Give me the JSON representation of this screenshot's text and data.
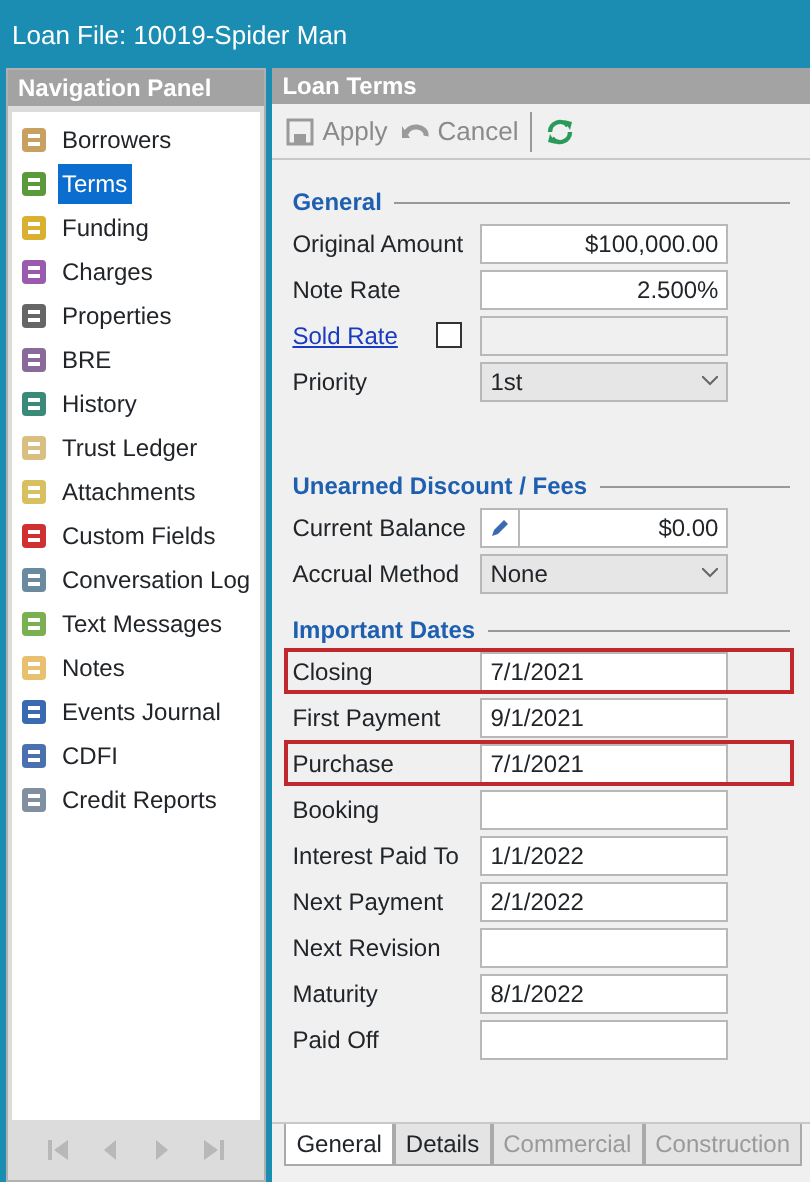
{
  "window": {
    "title": "Loan File: 10019-Spider Man"
  },
  "navigation_panel": {
    "title": "Navigation Panel",
    "items": [
      {
        "label": "Borrowers",
        "selected": false
      },
      {
        "label": "Terms",
        "selected": true
      },
      {
        "label": "Funding",
        "selected": false
      },
      {
        "label": "Charges",
        "selected": false
      },
      {
        "label": "Properties",
        "selected": false
      },
      {
        "label": "BRE",
        "selected": false
      },
      {
        "label": "History",
        "selected": false
      },
      {
        "label": "Trust Ledger",
        "selected": false
      },
      {
        "label": "Attachments",
        "selected": false
      },
      {
        "label": "Custom Fields",
        "selected": false
      },
      {
        "label": "Conversation Log",
        "selected": false
      },
      {
        "label": "Text Messages",
        "selected": false
      },
      {
        "label": "Notes",
        "selected": false
      },
      {
        "label": "Events Journal",
        "selected": false
      },
      {
        "label": "CDFI",
        "selected": false
      },
      {
        "label": "Credit Reports",
        "selected": false
      }
    ]
  },
  "loan_terms": {
    "title": "Loan Terms",
    "toolbar": [
      {
        "label": "Apply",
        "kind": "save",
        "disabled": true
      },
      {
        "label": "Cancel",
        "kind": "undo",
        "disabled": true
      },
      {
        "kind": "refresh",
        "disabled": false
      }
    ],
    "sections": [
      {
        "title": "General",
        "fields": [
          {
            "label": "Original Amount",
            "kind": "number",
            "value": "$100,000.00"
          },
          {
            "label": "Note Rate",
            "kind": "number",
            "value": "2.500%"
          },
          {
            "label": "Sold Rate",
            "kind": "link-check",
            "checked": false
          },
          {
            "label": "Priority",
            "kind": "select",
            "value": "1st"
          }
        ]
      },
      {
        "title": "Unearned Discount / Fees",
        "fields": [
          {
            "label": "Current Balance",
            "kind": "edit-number",
            "value": "$0.00"
          },
          {
            "label": "Accrual Method",
            "kind": "select",
            "value": "None"
          }
        ]
      },
      {
        "title": "Important Dates",
        "fields": [
          {
            "label": "Closing",
            "kind": "date",
            "value": "7/1/2021",
            "highlighted": true
          },
          {
            "label": "First Payment",
            "kind": "date",
            "value": "9/1/2021",
            "highlighted": false
          },
          {
            "label": "Purchase",
            "kind": "date",
            "value": "7/1/2021",
            "highlighted": true
          },
          {
            "label": "Booking",
            "kind": "date",
            "highlighted": false
          },
          {
            "label": "Interest Paid To",
            "kind": "date",
            "value": "1/1/2022",
            "highlighted": false
          },
          {
            "label": "Next Payment",
            "kind": "date",
            "value": "2/1/2022",
            "highlighted": false
          },
          {
            "label": "Next Revision",
            "kind": "date",
            "highlighted": false
          },
          {
            "label": "Maturity",
            "kind": "date",
            "value": "8/1/2022",
            "highlighted": false
          },
          {
            "label": "Paid Off",
            "kind": "date",
            "highlighted": false
          }
        ]
      }
    ],
    "tabs": [
      {
        "label": "General",
        "selected": true,
        "disabled": false
      },
      {
        "label": "Details",
        "selected": false,
        "disabled": false
      },
      {
        "label": "Commercial",
        "selected": false,
        "disabled": true
      },
      {
        "label": "Construction",
        "selected": false,
        "disabled": true
      }
    ]
  }
}
